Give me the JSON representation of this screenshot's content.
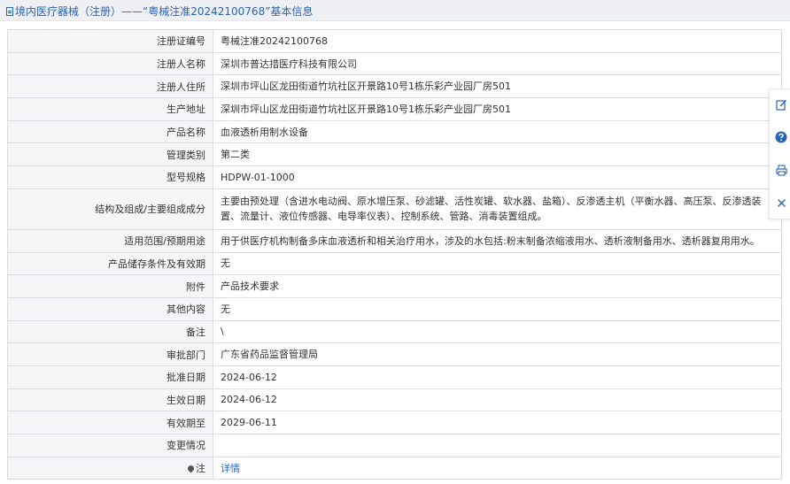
{
  "header": {
    "title": "境内医疗器械（注册）——“粤械注准20242100768”基本信息"
  },
  "rows": [
    {
      "label": "注册证编号",
      "value": "粤械注准20242100768"
    },
    {
      "label": "注册人名称",
      "value": "深圳市普达措医疗科技有限公司"
    },
    {
      "label": "注册人住所",
      "value": "深圳市坪山区龙田街道竹坑社区开景路10号1栋乐彩产业园厂房501"
    },
    {
      "label": "生产地址",
      "value": "深圳市坪山区龙田街道竹坑社区开景路10号1栋乐彩产业园厂房501"
    },
    {
      "label": "产品名称",
      "value": "血液透析用制水设备"
    },
    {
      "label": "管理类别",
      "value": "第二类"
    },
    {
      "label": "型号规格",
      "value": "HDPW-01-1000"
    },
    {
      "label": "结构及组成/主要组成成分",
      "value": "主要由预处理（含进水电动阀、原水增压泵、砂滤罐、活性炭罐、软水器、盐箱）、反渗透主机（平衡水器、高压泵、反渗透装置、流量计、液位传感器、电导率仪表）、控制系统、管路、消毒装置组成。"
    },
    {
      "label": "适用范围/预期用途",
      "value": "用于供医疗机构制备多床血液透析和相关治疗用水，涉及的水包括:粉末制备浓缩液用水、透析液制备用水、透析器复用用水。"
    },
    {
      "label": "产品储存条件及有效期",
      "value": "无"
    },
    {
      "label": "附件",
      "value": "产品技术要求"
    },
    {
      "label": "其他内容",
      "value": "无"
    },
    {
      "label": "备注",
      "value": "\\"
    },
    {
      "label": "审批部门",
      "value": "广东省药品监督管理局"
    },
    {
      "label": "批准日期",
      "value": "2024-06-12"
    },
    {
      "label": "生效日期",
      "value": "2024-06-12"
    },
    {
      "label": "有效期至",
      "value": "2029-06-11"
    },
    {
      "label": "变更情况",
      "value": ""
    }
  ],
  "note_row": {
    "label": "注",
    "link": "详情"
  },
  "sidetools": {
    "icons": [
      "edit-icon",
      "help-icon",
      "print-icon",
      "close-icon"
    ]
  },
  "colors": {
    "link": "#2a64b6",
    "label_bg": "#f5f6f8",
    "border": "#d9dde3"
  }
}
